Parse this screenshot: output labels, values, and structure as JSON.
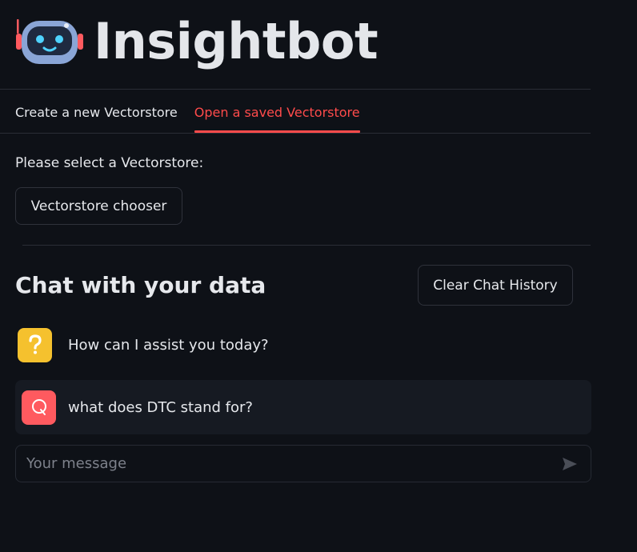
{
  "app": {
    "title": "Insightbot"
  },
  "tabs": [
    {
      "label": "Create a new Vectorstore",
      "active": false
    },
    {
      "label": "Open a saved Vectorstore",
      "active": true
    }
  ],
  "vectorstore": {
    "select_label": "Please select a Vectorstore:",
    "chooser_button": "Vectorstore chooser"
  },
  "chat": {
    "heading": "Chat with your data",
    "clear_button": "Clear Chat History",
    "messages": [
      {
        "role": "assistant",
        "avatar_icon": "question-mark-icon",
        "text": "How can I assist you today?"
      },
      {
        "role": "user",
        "avatar_icon": "speech-bubble-q-icon",
        "text": "what does DTC stand for?"
      }
    ],
    "input": {
      "placeholder": "Your message",
      "value": ""
    },
    "send_icon": "send-arrow-icon"
  },
  "colors": {
    "background": "#0e1117",
    "accent": "#ff4b4b",
    "assistant_avatar": "#f5c12e",
    "user_avatar": "#ff5a5f"
  }
}
